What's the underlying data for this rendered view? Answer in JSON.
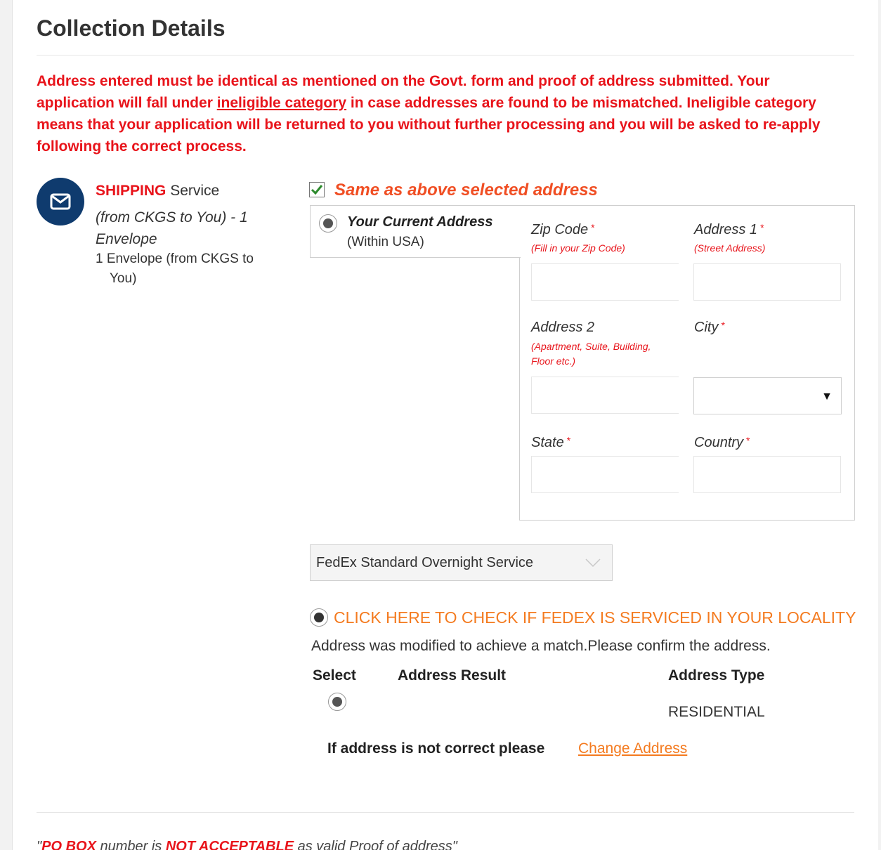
{
  "section": {
    "title": "Collection Details"
  },
  "warning": {
    "part1": "Address entered must be identical as mentioned on the Govt. form and proof of address submitted. Your application will fall under ",
    "link": "ineligible category",
    "part2": " in case addresses are found to be mismatched. Ineligible category means that your application will be returned to you without further processing and you will be asked to re-apply following the correct process."
  },
  "service": {
    "icon": "envelope-icon",
    "name_red": "SHIPPING",
    "name_rest": " Service",
    "subtitle": "(from CKGS to You) - 1 Envelope",
    "item": "1 Envelope (from CKGS to You)"
  },
  "same_address": {
    "label": "Same as above selected address",
    "checked": true
  },
  "address_tab": {
    "label": "Your Current Address",
    "sub": "(Within USA)",
    "selected": true
  },
  "form": {
    "zip": {
      "label": "Zip Code",
      "hint": "(Fill in your Zip Code)",
      "value": ""
    },
    "address1": {
      "label": "Address 1",
      "hint": "(Street Address)",
      "value": ""
    },
    "address2": {
      "label": "Address 2",
      "hint": "(Apartment, Suite, Building, Floor etc.)",
      "value": ""
    },
    "city": {
      "label": "City",
      "value": ""
    },
    "state": {
      "label": "State",
      "value": ""
    },
    "country": {
      "label": "Country",
      "value": ""
    },
    "required_mark": "*"
  },
  "shipping_service": {
    "selected": "FedEx Standard Overnight Service"
  },
  "fedex_check": {
    "label": "CLICK HERE TO CHECK IF FEDEX IS SERVICED IN YOUR LOCALITY"
  },
  "match_message": "Address was modified to achieve a match.Please confirm the address.",
  "results_table": {
    "headers": [
      "Select",
      "Address Result",
      "Address Type"
    ],
    "rows": [
      {
        "selected": true,
        "address_result": "",
        "address_type": "RESIDENTIAL"
      }
    ]
  },
  "change": {
    "prompt": "If address is not correct please",
    "link": "Change Address"
  },
  "pobox_note": {
    "q1": "\"",
    "po": "PO BOX",
    "mid": " number is ",
    "not": "NOT ACCEPTABLE",
    "end": " as valid Proof of address\""
  },
  "colors": {
    "warning_red": "#e8141b",
    "accent_orange": "#f47b20",
    "navy": "#0f3b6e"
  }
}
